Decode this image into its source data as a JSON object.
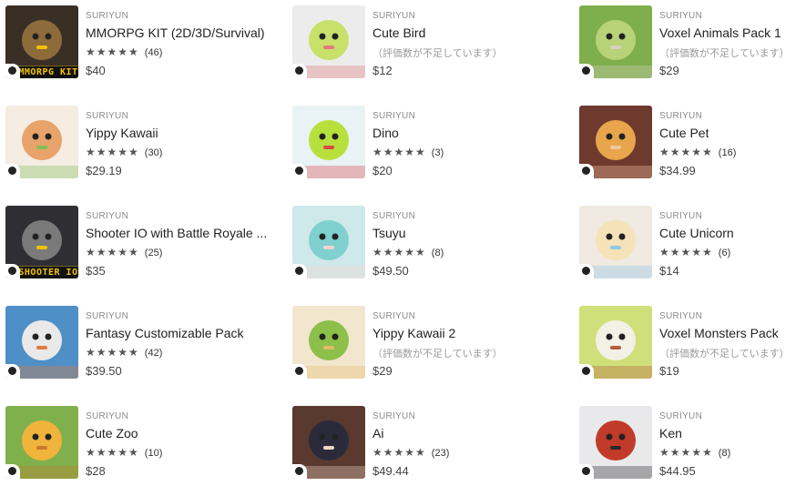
{
  "assets": [
    {
      "publisher": "SURIYUN",
      "title": "MMORPG KIT (2D/3D/Survival)",
      "stars": "★★★★★",
      "rating_count": "(46)",
      "no_rating": "",
      "price": "$40",
      "banner": "MMORPG KIT",
      "colors": [
        "#3a2f25",
        "#8e6b3a",
        "#f2c200"
      ]
    },
    {
      "publisher": "SURIYUN",
      "title": "Cute Bird",
      "stars": "",
      "rating_count": "",
      "no_rating": "（評価数が不足しています）",
      "price": "$12",
      "banner": "",
      "colors": [
        "#ececec",
        "#c9e06b",
        "#e07a7a"
      ]
    },
    {
      "publisher": "SURIYUN",
      "title": "Voxel Animals Pack 1",
      "stars": "",
      "rating_count": "",
      "no_rating": "（評価数が不足しています）",
      "price": "$29",
      "banner": "",
      "colors": [
        "#7fae4c",
        "#b8d27a",
        "#d8d0c0"
      ]
    },
    {
      "publisher": "SURIYUN",
      "title": "Yippy Kawaii",
      "stars": "★★★★★",
      "rating_count": "(30)",
      "no_rating": "",
      "price": "$29.19",
      "banner": "",
      "colors": [
        "#f5ece2",
        "#e8a36a",
        "#7fbf5a"
      ]
    },
    {
      "publisher": "SURIYUN",
      "title": "Dino",
      "stars": "★★★★★",
      "rating_count": "(3)",
      "no_rating": "",
      "price": "$20",
      "banner": "",
      "colors": [
        "#e9f2f5",
        "#b7e03c",
        "#d94a4a"
      ]
    },
    {
      "publisher": "SURIYUN",
      "title": "Cute Pet",
      "stars": "★★★★★",
      "rating_count": "(16)",
      "no_rating": "",
      "price": "$34.99",
      "banner": "",
      "colors": [
        "#6e3a2e",
        "#e8a54c",
        "#f3c6a0"
      ]
    },
    {
      "publisher": "SURIYUN",
      "title": "Shooter IO with Battle Royale ...",
      "stars": "★★★★★",
      "rating_count": "(25)",
      "no_rating": "",
      "price": "$35",
      "banner": "SHOOTER IO",
      "colors": [
        "#2f2f33",
        "#7a7a7a",
        "#f2c200"
      ]
    },
    {
      "publisher": "SURIYUN",
      "title": "Tsuyu",
      "stars": "★★★★★",
      "rating_count": "(8)",
      "no_rating": "",
      "price": "$49.50",
      "banner": "",
      "colors": [
        "#cfe8ea",
        "#7fd0cf",
        "#f0d6cf"
      ]
    },
    {
      "publisher": "SURIYUN",
      "title": "Cute Unicorn",
      "stars": "★★★★★",
      "rating_count": "(6)",
      "no_rating": "",
      "price": "$14",
      "banner": "",
      "colors": [
        "#efe9e2",
        "#f6e2b8",
        "#8fc7e8"
      ]
    },
    {
      "publisher": "SURIYUN",
      "title": "Fantasy Customizable Pack",
      "stars": "★★★★★",
      "rating_count": "(42)",
      "no_rating": "",
      "price": "$39.50",
      "banner": "",
      "colors": [
        "#4f8fc7",
        "#e9e9e9",
        "#e07a3a"
      ]
    },
    {
      "publisher": "SURIYUN",
      "title": "Yippy Kawaii 2",
      "stars": "",
      "rating_count": "",
      "no_rating": "（評価数が不足しています）",
      "price": "$29",
      "banner": "",
      "colors": [
        "#f2e6cf",
        "#8cc04a",
        "#e8b96a"
      ]
    },
    {
      "publisher": "SURIYUN",
      "title": "Voxel Monsters Pack",
      "stars": "",
      "rating_count": "",
      "no_rating": "（評価数が不足しています）",
      "price": "$19",
      "banner": "",
      "colors": [
        "#cfe07a",
        "#f1f1e6",
        "#b85a3a"
      ]
    },
    {
      "publisher": "SURIYUN",
      "title": "Cute Zoo",
      "stars": "★★★★★",
      "rating_count": "(10)",
      "no_rating": "",
      "price": "$28",
      "banner": "",
      "colors": [
        "#7fb04c",
        "#f0b43c",
        "#c97a2e"
      ]
    },
    {
      "publisher": "SURIYUN",
      "title": "Ai",
      "stars": "★★★★★",
      "rating_count": "(23)",
      "no_rating": "",
      "price": "$49.44",
      "banner": "",
      "colors": [
        "#5a3a2e",
        "#2a2a3a",
        "#f2d6c6"
      ]
    },
    {
      "publisher": "SURIYUN",
      "title": "Ken",
      "stars": "★★★★★",
      "rating_count": "(8)",
      "no_rating": "",
      "price": "$44.95",
      "banner": "",
      "colors": [
        "#e9e9ec",
        "#c23a2a",
        "#2a2a2a"
      ]
    }
  ]
}
